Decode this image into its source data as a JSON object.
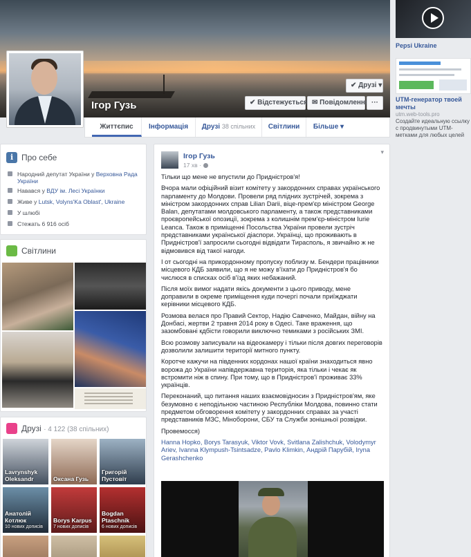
{
  "profile": {
    "name": "Ігор Гузь",
    "buttons": {
      "friends": "✔ Друзі ▾",
      "follow": "✔ Відстежується",
      "message": "✉ Повідомлення",
      "more": "···"
    }
  },
  "tabs": [
    {
      "label": "Життєпис"
    },
    {
      "label": "Інформація"
    },
    {
      "label": "Друзі",
      "count": "38 спільних"
    },
    {
      "label": "Світлини"
    },
    {
      "label": "Більше ▾"
    }
  ],
  "ads": {
    "ad1_title": "Pepsi Ukraine",
    "ad2_title": "UTM-генератор твоей мечты",
    "ad2_url": "utm.web-tools.pro",
    "ad2_desc": "Создайте идеальную ссылку с продвинутыми UTM-метками для любых целей"
  },
  "about": {
    "title": "Про себе",
    "rows": [
      {
        "prefix": "Народний депутат України у ",
        "link": "Верховна Рада України"
      },
      {
        "prefix": "Навався у ",
        "link": "ВДУ ім. Лесі Українки"
      },
      {
        "prefix": "Живе у ",
        "link": "Lutsk, Volyns'Ka Oblast', Ukraine"
      },
      {
        "prefix": "У шлюбі",
        "link": ""
      },
      {
        "prefix": "Стежать 6 916 осіб",
        "link": ""
      }
    ]
  },
  "photos": {
    "title": "Світлини"
  },
  "friends": {
    "title": "Друзі",
    "count": "· 4 122 (38 спільних)",
    "items": [
      {
        "name": "Lavrynshyk Oleksandr",
        "sub": ""
      },
      {
        "name": "Оксана Гузь",
        "sub": ""
      },
      {
        "name": "Григорій Пустовіт",
        "sub": ""
      },
      {
        "name": "Анатолій Котлюк",
        "sub": "10 нових дописів"
      },
      {
        "name": "Borys Karpus",
        "sub": "7 нових дописів"
      },
      {
        "name": "Bogdan Ptaschnik",
        "sub": "6 нових дописів"
      },
      {
        "name": "",
        "sub": ""
      },
      {
        "name": "",
        "sub": ""
      },
      {
        "name": "",
        "sub": ""
      }
    ]
  },
  "post": {
    "author": "Ігор Гузь",
    "time": "17 хв ·",
    "paragraphs": [
      "Тільки що мене не впустили до Придністров'я!",
      "Вчора мали офіційний візит комітету у закордонних справах українського парламенту до Молдови. Провели ряд плідних зустрічей, зокрема з міністром закордонних справ Lilian Darii, віце-прем'єр міністром George Balan, депутатами молдовського парламенту, а також представниками проєвропейської опозиції, зокрема з колишнім прем'єр-міністром Iurie Leanca. Також в приміщенні Посольства України провели зустріч представниками української діаспори. Українці, що проживають в Придністров'ї запросили сьогодні відвідати Тирасполь, я звичайно ж не відмовився від такої нагоди.",
      "І от сьогодні на прикордонному пропуску поблизу м. Бендери працівники місцевого КДБ заявили, що я не можу в'їхати до Придністров'я бо числюся в списках осіб в'їзд яких небажаний.",
      "Після моїх вимог надати якісь документи з цього приводу, мене доправили в окреме приміщення куди почергі почали приїжджати керівники місцевого КДБ.",
      "Розмова велася про Правий Сектор, Надію Савченко, Майдан, війну на Донбасі, жертви 2 травня 2014 року в Одесі. Таке враження, що зазомбовані кдбісти говорили виключно темиками з російських ЗМІ.",
      "Всю розмову записували на відеокамеру і тільки після довгих переговорів дозволили залишити території митного пункту.",
      "Коротче кажучи на південних кордонах нашої країни знаходиться явно ворожа до України напівдержавна територія, яка тільки і чекає як встромити ніж в спину. При тому, що в Придністров'ї проживає 33% українців.",
      "Переконаний, що питання наших взаємовідносин з Придністров'ям, яке безумовно є неподільною частиною Республіки Молдова, повинно стати предметом обговорення комітету у закордонних справах за участі представників МЗС, Міноборони, СБУ та Служби зонішньої розвідки.",
      "Пpовемосся)"
    ],
    "tags": "Hanna Hopko, Borys Tarasyuk, Viktor Vovk, Svitlana Zalishchuk, Volodymyr Ariev, Ivanna Klympush-Tsintsadze, Pavlo Klimkin, Андрій Парубій, Iryna Gerashchenko"
  }
}
